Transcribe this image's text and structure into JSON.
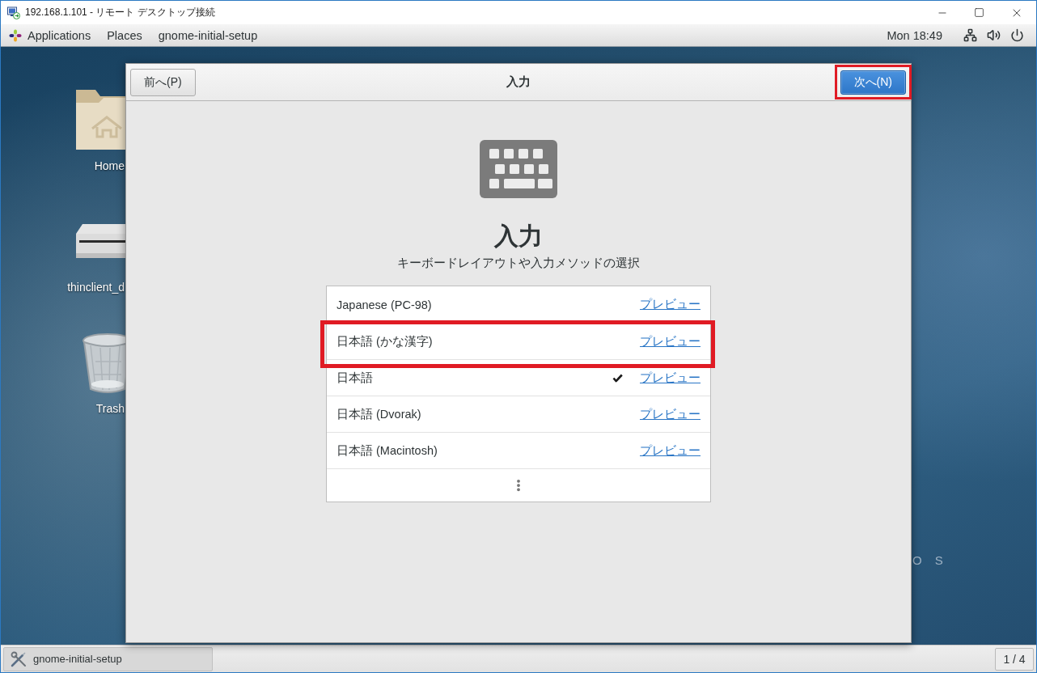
{
  "remote_window": {
    "title": "192.168.1.101 - リモート デスクトップ接続"
  },
  "top_panel": {
    "menus": [
      {
        "kind": "applications",
        "label": "Applications"
      },
      {
        "kind": "places",
        "label": "Places"
      },
      {
        "kind": "app",
        "label": "gnome-initial-setup"
      }
    ],
    "clock": "Mon 18:49"
  },
  "desktop_icons": [
    {
      "kind": "folder",
      "label": "Home"
    },
    {
      "kind": "drive",
      "label": "thinclient_d"
    },
    {
      "kind": "trash",
      "label": "Trash"
    }
  ],
  "wallpaper_text": "O S",
  "dialog": {
    "title": "入力",
    "back_button": {
      "label": "前へ(P)",
      "highlighted": false
    },
    "next_button": {
      "label": "次へ(N)",
      "highlighted": true
    },
    "heading": "入力",
    "subtitle": "キーボードレイアウトや入力メソッドの選択",
    "layouts": [
      {
        "name": "Japanese (PC-98)",
        "selected": false,
        "highlighted": false,
        "preview": "プレビュー"
      },
      {
        "name": "日本語 (かな漢字)",
        "selected": false,
        "highlighted": true,
        "preview": "プレビュー"
      },
      {
        "name": "日本語",
        "selected": true,
        "highlighted": false,
        "preview": "プレビュー"
      },
      {
        "name": "日本語 (Dvorak)",
        "selected": false,
        "highlighted": false,
        "preview": "プレビュー"
      },
      {
        "name": "日本語 (Macintosh)",
        "selected": false,
        "highlighted": false,
        "preview": "プレビュー"
      }
    ]
  },
  "taskbar": {
    "task": "gnome-initial-setup",
    "workspace": "1 / 4"
  }
}
